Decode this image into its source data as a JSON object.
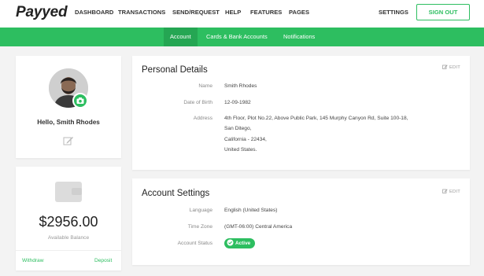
{
  "brand": {
    "logo": "Payyed",
    "accent": "#2dbe60"
  },
  "nav": {
    "items": [
      "DASHBOARD",
      "TRANSACTIONS",
      "SEND/REQUEST",
      "HELP",
      "FEATURES",
      "PAGES"
    ],
    "settings": "SETTINGS",
    "signout": "SIGN OUT"
  },
  "subnav": {
    "tabs": [
      "Account",
      "Cards & Bank Accounts",
      "Notifications"
    ],
    "active": "Account"
  },
  "profile": {
    "greeting": "Hello, Smith Rhodes"
  },
  "wallet": {
    "balance": "$2956.00",
    "balance_label": "Available Balance",
    "withdraw": "Withdraw",
    "deposit": "Deposit"
  },
  "personal": {
    "title": "Personal Details",
    "edit": "EDIT",
    "name_label": "Name",
    "name": "Smith Rhodes",
    "dob_label": "Date of Birth",
    "dob": "12-09-1982",
    "address_label": "Address",
    "address_lines": [
      "4th Floor, Plot No.22, Above Public Park, 145 Murphy Canyon Rd, Suite 100-18,",
      "San Ditego,",
      "California - 22434,",
      "United States."
    ]
  },
  "account": {
    "title": "Account Settings",
    "edit": "EDIT",
    "language_label": "Language",
    "language": "English (United States)",
    "timezone_label": "Time Zone",
    "timezone": "(GMT-06:00) Central America",
    "status_label": "Account Status",
    "status": "Active"
  }
}
